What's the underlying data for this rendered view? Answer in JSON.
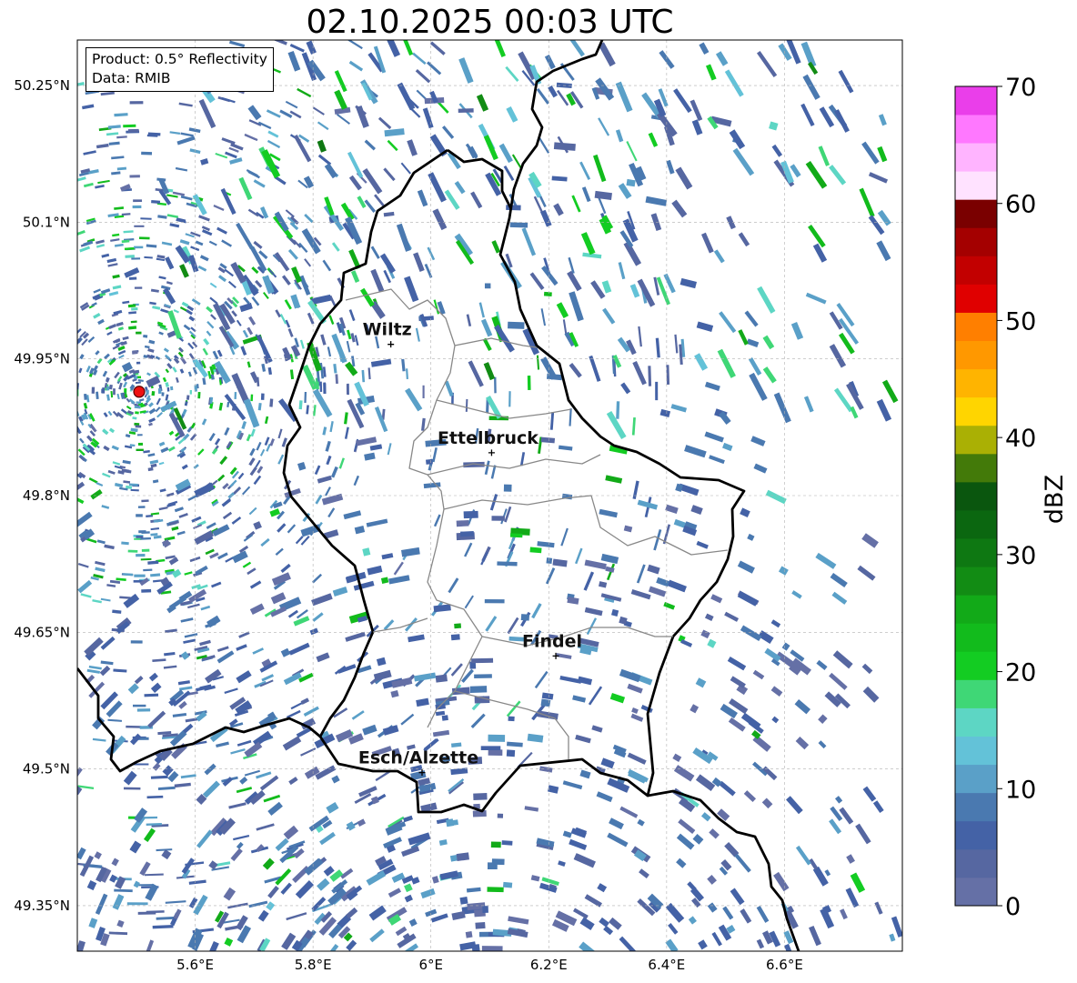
{
  "title": "02.10.2025 00:03 UTC",
  "info": {
    "product": "Product: 0.5° Reflectivity",
    "source": "Data: RMIB"
  },
  "map": {
    "lon_range": [
      5.4,
      6.8
    ],
    "lat_range": [
      49.3,
      50.3
    ],
    "x_ticks": [
      {
        "value": 5.6,
        "label": "5.6°E"
      },
      {
        "value": 5.8,
        "label": "5.8°E"
      },
      {
        "value": 6.0,
        "label": "6°E"
      },
      {
        "value": 6.2,
        "label": "6.2°E"
      },
      {
        "value": 6.4,
        "label": "6.4°E"
      },
      {
        "value": 6.6,
        "label": "6.6°E"
      }
    ],
    "y_ticks": [
      {
        "value": 50.25,
        "label": "50.25°N"
      },
      {
        "value": 50.1,
        "label": "50.1°N"
      },
      {
        "value": 49.95,
        "label": "49.95°N"
      },
      {
        "value": 49.8,
        "label": "49.8°N"
      },
      {
        "value": 49.65,
        "label": "49.65°N"
      },
      {
        "value": 49.5,
        "label": "49.5°N"
      },
      {
        "value": 49.35,
        "label": "49.35°N"
      }
    ],
    "radar_site": {
      "lon": 5.505,
      "lat": 49.914
    },
    "cities": [
      {
        "name": "Wiltz",
        "lon": 5.932,
        "lat": 49.966
      },
      {
        "name": "Ettelbruck",
        "lon": 6.103,
        "lat": 49.847
      },
      {
        "name": "Findel",
        "lon": 6.212,
        "lat": 49.624
      },
      {
        "name": "Esch/Alzette",
        "lon": 5.985,
        "lat": 49.496
      }
    ],
    "border_color": "#000000",
    "canton_color": "#888888"
  },
  "colorbar": {
    "label": "dBZ",
    "min": 0,
    "max": 70,
    "ticks": [
      0,
      10,
      20,
      30,
      40,
      50,
      60,
      70
    ],
    "colors": [
      "#6570a6",
      "#5667a1",
      "#4462a6",
      "#4a79b0",
      "#5aa0c8",
      "#63c2d8",
      "#5dd6c4",
      "#3fd776",
      "#13cc22",
      "#12bb1c",
      "#12aa18",
      "#128c14",
      "#0e7812",
      "#0b6710",
      "#0a560e",
      "#437a09",
      "#aab004",
      "#ffd500",
      "#ffb400",
      "#ff9800",
      "#ff7f00",
      "#e00000",
      "#c20000",
      "#a40000",
      "#7a0000",
      "#ffe2ff",
      "#ffb4ff",
      "#ff78ff",
      "#ea3eea"
    ]
  }
}
